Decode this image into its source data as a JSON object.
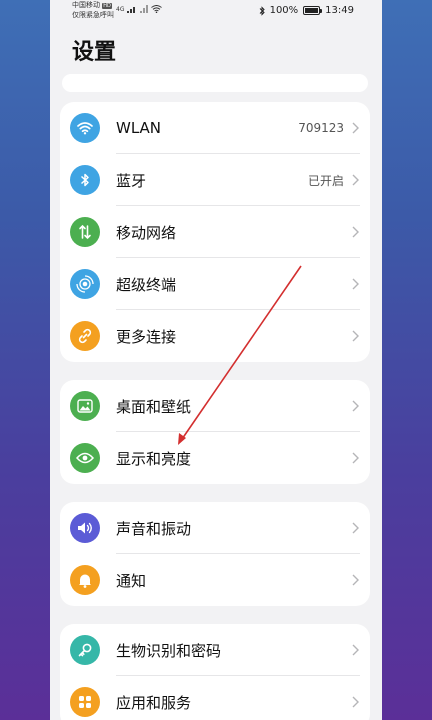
{
  "statusbar": {
    "carrier": "中国移动",
    "carrier_badge": "HD",
    "emergency": "仅限紧急呼叫",
    "network": "4G",
    "battery": "100%",
    "battery_level": 1.0,
    "time": "13:49"
  },
  "page": {
    "title": "设置"
  },
  "groups": [
    {
      "items": [
        {
          "label": "WLAN",
          "value": "709123",
          "icon": "wifi-icon",
          "color": "#3fa4e3"
        },
        {
          "label": "蓝牙",
          "value": "已开启",
          "icon": "bluetooth-icon",
          "color": "#3fa4e3"
        },
        {
          "label": "移动网络",
          "value": "",
          "icon": "mobile-data-icon",
          "color": "#4caf50"
        },
        {
          "label": "超级终端",
          "value": "",
          "icon": "super-device-icon",
          "color": "#3fa4e3"
        },
        {
          "label": "更多连接",
          "value": "",
          "icon": "link-icon",
          "color": "#f4a020"
        }
      ]
    },
    {
      "items": [
        {
          "label": "桌面和壁纸",
          "value": "",
          "icon": "wallpaper-icon",
          "color": "#4caf50"
        },
        {
          "label": "显示和亮度",
          "value": "",
          "icon": "eye-icon",
          "color": "#4caf50"
        }
      ]
    },
    {
      "items": [
        {
          "label": "声音和振动",
          "value": "",
          "icon": "speaker-icon",
          "color": "#5b5bd6"
        },
        {
          "label": "通知",
          "value": "",
          "icon": "bell-icon",
          "color": "#f4a020"
        }
      ]
    },
    {
      "items": [
        {
          "label": "生物识别和密码",
          "value": "",
          "icon": "key-icon",
          "color": "#36b7a8"
        },
        {
          "label": "应用和服务",
          "value": "",
          "icon": "apps-icon",
          "color": "#f4a020"
        }
      ]
    }
  ],
  "colors": {
    "background": "#f2f2f4",
    "card": "#ffffff",
    "annotation_arrow": "#d32f2f"
  }
}
